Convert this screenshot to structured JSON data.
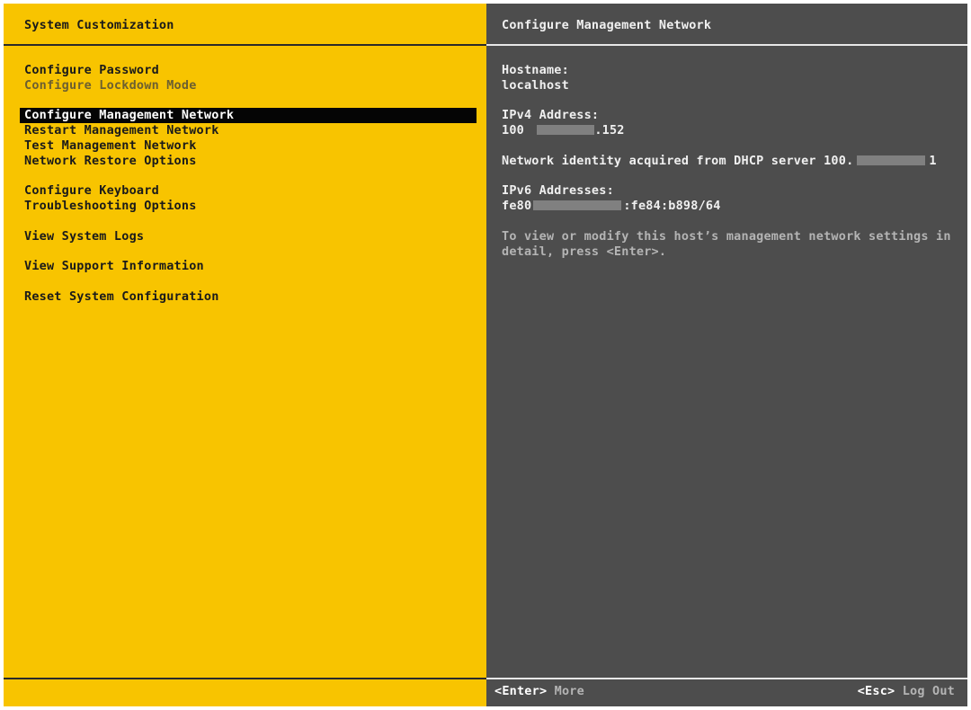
{
  "left_panel": {
    "title": "System Customization",
    "menu": [
      {
        "label": "Configure Password"
      },
      {
        "label": "Configure Lockdown Mode"
      },
      {
        "label": "Configure Management Network"
      },
      {
        "label": "Restart Management Network"
      },
      {
        "label": "Test Management Network"
      },
      {
        "label": "Network Restore Options"
      },
      {
        "label": "Configure Keyboard"
      },
      {
        "label": "Troubleshooting Options"
      },
      {
        "label": "View System Logs"
      },
      {
        "label": "View Support Information"
      },
      {
        "label": "Reset System Configuration"
      }
    ]
  },
  "right_panel": {
    "title": "Configure Management Network",
    "hostname_label": "Hostname:",
    "hostname_value": "localhost",
    "ipv4_label": "IPv4 Address:",
    "ipv4_value_prefix": "100",
    "ipv4_value_suffix": ".152",
    "dhcp_text": "Network identity acquired from DHCP server 100.",
    "dhcp_suffix": "1",
    "ipv6_label": "IPv6 Addresses:",
    "ipv6_value_prefix": "fe80",
    "ipv6_value_suffix": ":fe84:b898/64",
    "help_text": "To view or modify this host’s management network settings in detail, press <Enter>.",
    "footer": {
      "enter_key": "<Enter>",
      "enter_desc": "More",
      "esc_key": "<Esc>",
      "esc_desc": "Log Out"
    }
  },
  "colors": {
    "left_background": "#f8c400",
    "right_background": "#4d4d4d",
    "selection_background": "#050505"
  }
}
